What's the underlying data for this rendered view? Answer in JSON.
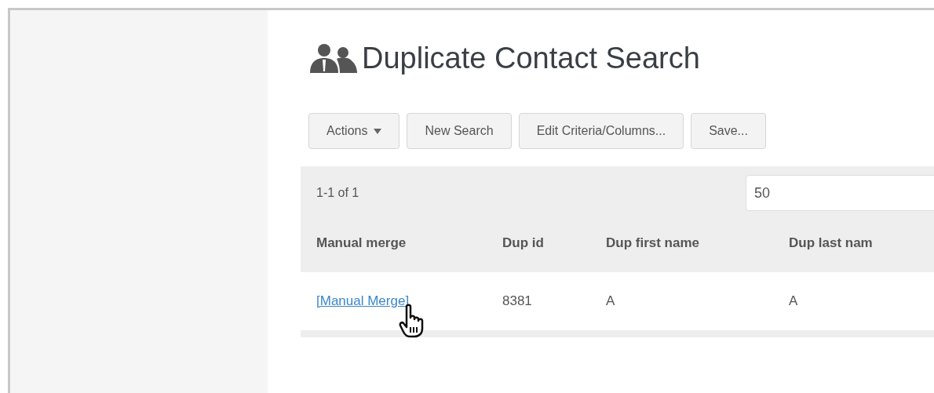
{
  "title": "Duplicate Contact Search",
  "toolbar": [
    {
      "label": "Actions",
      "kind": "dropdown"
    },
    {
      "label": "New Search",
      "kind": "button"
    },
    {
      "label": "Edit Criteria/Columns...",
      "kind": "button"
    },
    {
      "label": "Save...",
      "kind": "button"
    }
  ],
  "pager": {
    "range": "1-1 of 1",
    "page_size": "50"
  },
  "table": {
    "columns": [
      "Manual merge",
      "Dup id",
      "Dup first name",
      "Dup last nam"
    ],
    "rows": [
      [
        "[Manual Merge]",
        "8381",
        "A",
        "A"
      ]
    ]
  }
}
